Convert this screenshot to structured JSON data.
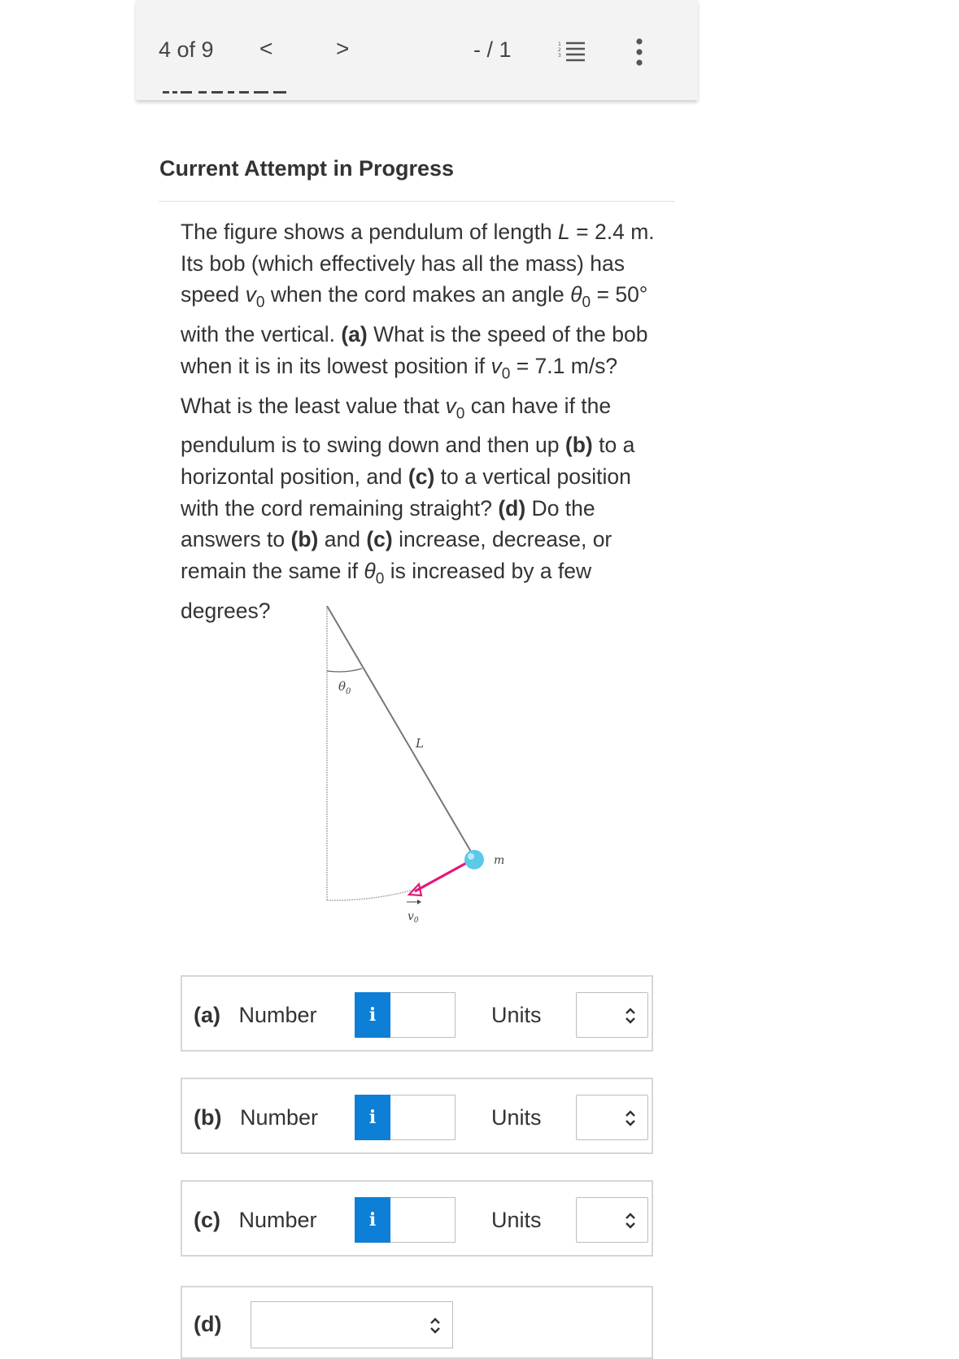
{
  "topbar": {
    "page_count": "4 of 9",
    "prev_glyph": "<",
    "next_glyph": ">",
    "score": "- / 1",
    "list_icon": "numbered-list-icon",
    "more_icon": "more-vertical-icon"
  },
  "header": {
    "attempt_title": "Current Attempt in Progress"
  },
  "question": {
    "segments": [
      {
        "t": "The figure shows a pendulum of length "
      },
      {
        "t": "L",
        "i": true
      },
      {
        "t": " = 2.4 m. Its bob (which effectively has all the mass) has speed "
      },
      {
        "t": "v",
        "i": true
      },
      {
        "t": "0",
        "sub": true
      },
      {
        "t": " when the cord makes an angle "
      },
      {
        "t": "θ",
        "i": true
      },
      {
        "t": "0",
        "sub": true
      },
      {
        "t": " = 50° with the vertical. "
      },
      {
        "t": "(a)",
        "b": true
      },
      {
        "t": " What is the speed of the bob when it is in its lowest position if "
      },
      {
        "t": "v",
        "i": true
      },
      {
        "t": "0",
        "sub": true
      },
      {
        "t": " = 7.1 m/s? What is the least value that "
      },
      {
        "t": "v",
        "i": true
      },
      {
        "t": "0",
        "sub": true
      },
      {
        "t": " can have if the pendulum is to swing down and then up "
      },
      {
        "t": "(b)",
        "b": true
      },
      {
        "t": " to a horizontal position, and "
      },
      {
        "t": "(c)",
        "b": true
      },
      {
        "t": " to a vertical position with the cord remaining straight? "
      },
      {
        "t": "(d)",
        "b": true
      },
      {
        "t": " Do the answers to "
      },
      {
        "t": "(b)",
        "b": true
      },
      {
        "t": " and "
      },
      {
        "t": "(c)",
        "b": true
      },
      {
        "t": " increase, decrease, or remain the same if "
      },
      {
        "t": "θ",
        "i": true
      },
      {
        "t": "0",
        "sub": true
      },
      {
        "t": " is increased by a few degrees?"
      }
    ]
  },
  "figure": {
    "angle_label": "θ",
    "angle_sub": "0",
    "length_label": "L",
    "mass_label": "m",
    "velocity_label": "v",
    "velocity_sub": "0",
    "bob_color": "#5ec8e8",
    "arrow_color": "#e0197a"
  },
  "answers": [
    {
      "part": "(a)",
      "type_label": "Number",
      "info_glyph": "i",
      "units_label": "Units",
      "value": ""
    },
    {
      "part": "(b)",
      "type_label": "Number",
      "info_glyph": "i",
      "units_label": "Units",
      "value": ""
    },
    {
      "part": "(c)",
      "type_label": "Number",
      "info_glyph": "i",
      "units_label": "Units",
      "value": ""
    }
  ],
  "part_d": {
    "part": "(d)",
    "selected": ""
  },
  "colors": {
    "info_button": "#0d7fd6",
    "topbar_bg": "#f3f3f3"
  }
}
